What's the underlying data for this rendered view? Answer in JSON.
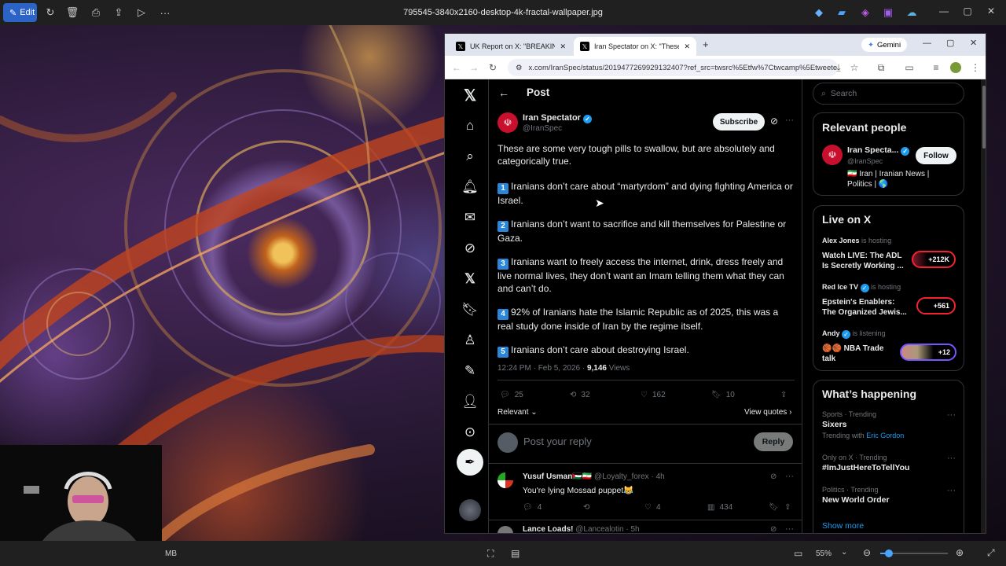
{
  "viewer": {
    "edit_label": "Edit",
    "file_title": "795545-3840x2160-desktop-4k-fractal-wallpaper.jpg",
    "size_text": "MB",
    "zoom": "55%"
  },
  "browser": {
    "tabs": [
      {
        "title": "UK Report on X: \"BREAKING -"
      },
      {
        "title": "Iran Spectator on X: \"These are"
      }
    ],
    "gemini_label": "Gemini",
    "url": "x.com/IranSpec/status/2019477269929132407?ref_src=twsrc%5Etfw%7Ctwcamp%5Etweete..."
  },
  "post": {
    "header": "Post",
    "author_name": "Iran Spectator",
    "author_handle": "@IranSpec",
    "subscribe_label": "Subscribe",
    "intro": "These are some very tough pills to swallow, but are absolutely and categorically true.",
    "points": [
      {
        "num": "1",
        "text": "Iranians don’t care about “martyrdom” and dying fighting America or Israel."
      },
      {
        "num": "2",
        "text": "Iranians don’t want to sacrifice and kill themselves for Palestine or Gaza."
      },
      {
        "num": "3",
        "text": "Iranians want to freely access the internet, drink, dress freely and live normal lives, they don’t want an Imam telling them what they can and can’t do."
      },
      {
        "num": "4",
        "text": "92% of Iranians hate the Islamic Republic as of 2025, this was a real study done inside of Iran by the regime itself."
      },
      {
        "num": "5",
        "text": "Iranians don’t care about destroying Israel."
      }
    ],
    "meta": "12:24 PM · Feb 5, 2026 · ",
    "views": "9,146",
    "views_label": " Views",
    "replies": "25",
    "reposts": "32",
    "likes": "162",
    "bookmarks": "10",
    "sort_label": "Relevant",
    "view_quotes": "View quotes",
    "reply_placeholder": "Post your reply",
    "reply_button": "Reply"
  },
  "replies": [
    {
      "name": "Yusuf Usman",
      "flags": "🇵🇸🇮🇷",
      "handle": "@Loyalty_forex",
      "time": "· 4h",
      "text": "You're lying Mossad puppet😹",
      "replies": "4",
      "likes": "4",
      "views": "434"
    },
    {
      "name": "Lance Loads!",
      "handle": "@Lancealotin",
      "time": "· 5h"
    }
  ],
  "sidebar": {
    "search_placeholder": "Search",
    "relevant_title": "Relevant people",
    "person": {
      "name": "Iran Specta...",
      "handle": "@IranSpec",
      "bio": "🇮🇷 Iran | Iranian News | Politics | 🌎",
      "follow": "Follow"
    },
    "live_title": "Live on X",
    "live": [
      {
        "host": "Alex Jones",
        "status": "is hosting",
        "title": "Watch LIVE: The ADL Is Secretly Working ...",
        "count": "+212K"
      },
      {
        "host": "Red Ice TV",
        "status": "is hosting",
        "title": "Epstein's Enablers: The Organized Jewis...",
        "count": "+561"
      },
      {
        "host": "Andy",
        "status": "is listening",
        "title": "🏀🏀 NBA Trade talk",
        "count": "+12"
      }
    ],
    "happening_title": "What’s happening",
    "trends": [
      {
        "context": "Sports · Trending",
        "title": "Sixers",
        "extra_prefix": "Trending with ",
        "extra_link": "Eric Gordon"
      },
      {
        "context": "Only on X · Trending",
        "title": "#ImJustHereToTellYou"
      },
      {
        "context": "Politics · Trending",
        "title": "New World Order"
      }
    ],
    "show_more": "Show more"
  },
  "colors": {
    "x_blue": "#1d9bf0",
    "live_red": "#f4212e",
    "edit_blue": "#2b63c7"
  }
}
